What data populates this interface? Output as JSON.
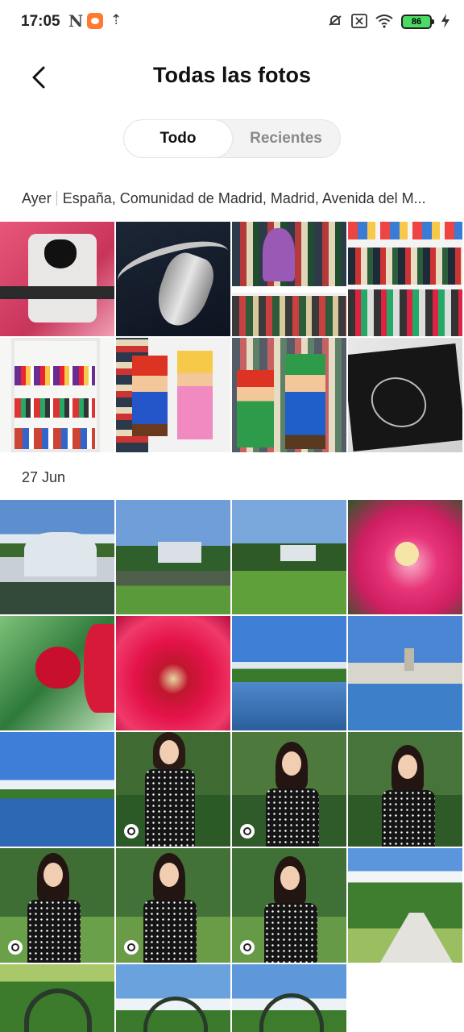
{
  "status_bar": {
    "time": "17:05",
    "n_icon": "N",
    "upload_icon": "⇡",
    "battery": "86"
  },
  "header": {
    "title": "Todas las fotos",
    "back_icon": "chevron-left-icon"
  },
  "tabs": [
    {
      "label": "Todo",
      "active": true
    },
    {
      "label": "Recientes",
      "active": false
    }
  ],
  "sections": [
    {
      "date": "Ayer",
      "location": "España, Comunidad de Madrid, Madrid, Avenida del M...",
      "photos": [
        {
          "subject": "pink bag with broken heart patch",
          "live": false
        },
        {
          "subject": "silver chain necklace",
          "live": false
        },
        {
          "subject": "bookshelf with pixel figures",
          "live": false
        },
        {
          "subject": "bookshelf with figurines",
          "live": false
        },
        {
          "subject": "white shelves with figurines",
          "live": false
        },
        {
          "subject": "pixel Mario and Peach",
          "live": false
        },
        {
          "subject": "pixel Mario and Luigi",
          "live": false
        },
        {
          "subject": "Death Note notebook",
          "live": false
        }
      ]
    },
    {
      "date": "27 Jun",
      "location": "",
      "photos": [
        {
          "subject": "glass palace with pond",
          "live": false
        },
        {
          "subject": "glass palace park",
          "live": false
        },
        {
          "subject": "glass palace lawn",
          "live": false
        },
        {
          "subject": "pink flower",
          "live": false
        },
        {
          "subject": "red rose bud",
          "live": false
        },
        {
          "subject": "red flower macro",
          "live": false
        },
        {
          "subject": "lake and monument",
          "live": false
        },
        {
          "subject": "monument over lake",
          "live": false
        },
        {
          "subject": "lake with blue sky",
          "live": false
        },
        {
          "subject": "woman in park",
          "live": true
        },
        {
          "subject": "woman in park",
          "live": true
        },
        {
          "subject": "woman in park",
          "live": false
        },
        {
          "subject": "woman in garden",
          "live": true
        },
        {
          "subject": "woman in garden",
          "live": true
        },
        {
          "subject": "woman in garden",
          "live": true
        },
        {
          "subject": "park path",
          "live": false
        },
        {
          "subject": "garden arches",
          "live": false
        },
        {
          "subject": "park with arches",
          "live": false
        },
        {
          "subject": "park with arches",
          "live": false
        }
      ]
    }
  ]
}
